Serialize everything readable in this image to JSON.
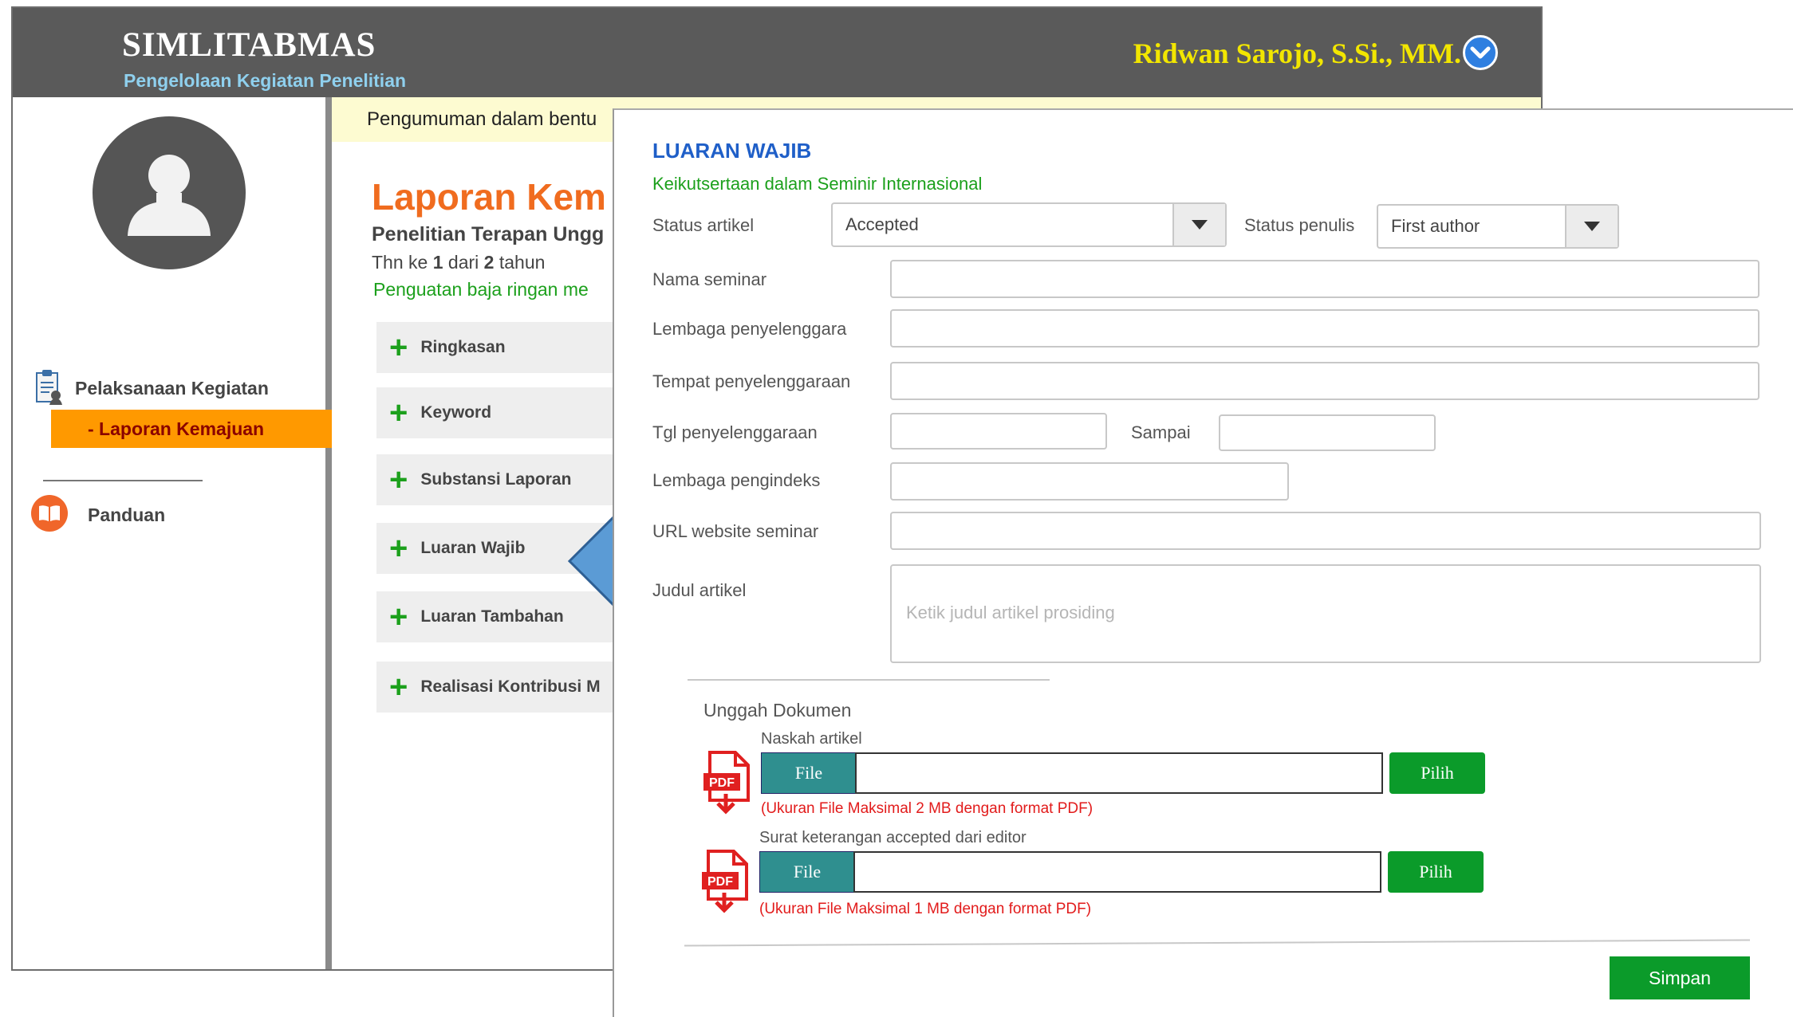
{
  "header": {
    "brand": "SIMLITABMAS",
    "subtitle": "Pengelolaan Kegiatan Penelitian",
    "user_name": "Ridwan Sarojo, S.Si., MM."
  },
  "sidebar": {
    "activity_label": "Pelaksanaan Kegiatan",
    "active_sub_item": "- Laporan Kemajuan",
    "guide_label": "Panduan"
  },
  "main": {
    "announcement": "Pengumuman dalam bentu",
    "report_title": "Laporan Kem",
    "report_subtitle": "Penelitian Terapan Ungg",
    "year_prefix": "Thn ke ",
    "year_current": "1",
    "year_mid": " dari ",
    "year_total": "2",
    "year_suffix": " tahun",
    "topic": "Penguatan baja ringan me",
    "sections": [
      "Ringkasan",
      "Keyword",
      "Substansi Laporan",
      "Luaran Wajib",
      "Luaran Tambahan",
      "Realisasi Kontribusi M"
    ]
  },
  "modal": {
    "title": "LUARAN WAJIB",
    "subtitle": "Keikutsertaan dalam Seminir Internasional",
    "status_artikel_label": "Status artikel",
    "status_artikel_value": "Accepted",
    "status_penulis_label": "Status penulis",
    "status_penulis_value": "First author",
    "nama_seminar_label": "Nama seminar",
    "lembaga_penyelenggara_label": "Lembaga penyelenggara",
    "tempat_label": "Tempat penyelenggaraan",
    "tgl_label": "Tgl penyelenggaraan",
    "sampai_label": "Sampai",
    "lembaga_pengindeks_label": "Lembaga pengindeks",
    "url_label": "URL website seminar",
    "judul_label": "Judul artikel",
    "judul_placeholder": "Ketik judul artikel prosiding",
    "upload_heading": "Unggah Dokumen",
    "uploads": [
      {
        "label": "Naskah artikel",
        "file_button": "File",
        "pick_button": "Pilih",
        "note": "(Ukuran File Maksimal 2 MB dengan format PDF)"
      },
      {
        "label": "Surat keterangan accepted dari editor",
        "file_button": "File",
        "pick_button": "Pilih",
        "note": "(Ukuran File Maksimal 1 MB dengan format PDF)"
      }
    ],
    "pdf_icon_text": "PDF",
    "save_button": "Simpan"
  },
  "colors": {
    "header_bg": "#5a5a5a",
    "brand_sub": "#8fd0ee",
    "user_name": "#f2e600",
    "accent_orange": "#ff9900",
    "report_title": "#f06c1f",
    "green": "#1ca01c",
    "modal_title": "#1f5fc8",
    "button_green": "#0b9b2a",
    "file_teal": "#2f8f8f",
    "note_red": "#e21b1b"
  }
}
